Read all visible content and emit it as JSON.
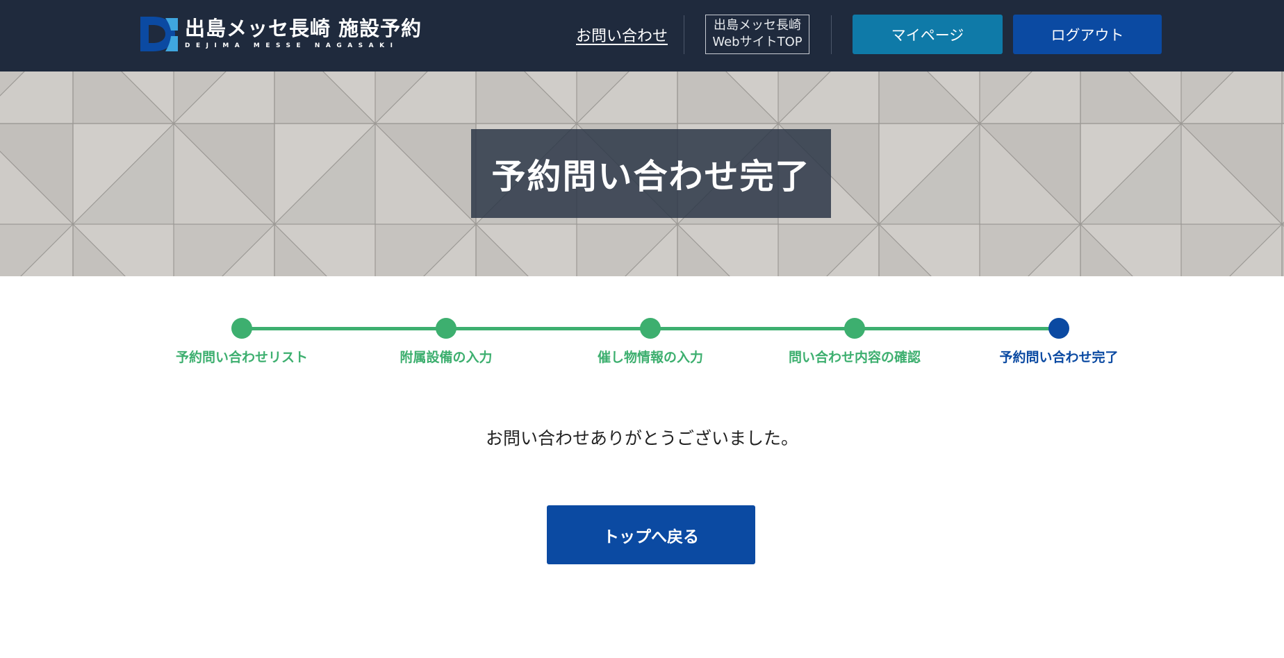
{
  "header": {
    "logo_title": "出島メッセ長崎 施設予約",
    "logo_subtitle": "DEJIMA MESSE NAGASAKI",
    "contact_link": "お問い合わせ",
    "site_top_line1": "出島メッセ長崎",
    "site_top_line2": "WebサイトTOP",
    "mypage_button": "マイページ",
    "logout_button": "ログアウト"
  },
  "hero": {
    "title": "予約問い合わせ完了"
  },
  "steps": [
    {
      "label": "予約問い合わせリスト",
      "status": "done"
    },
    {
      "label": "附属設備の入力",
      "status": "done"
    },
    {
      "label": "催し物情報の入力",
      "status": "done"
    },
    {
      "label": "問い合わせ内容の確認",
      "status": "done"
    },
    {
      "label": "予約問い合わせ完了",
      "status": "current"
    }
  ],
  "main": {
    "message": "お問い合わせありがとうございました。",
    "back_button": "トップへ戻る"
  },
  "colors": {
    "header_bg": "#1f2a3d",
    "step_done": "#3daf6f",
    "step_current": "#0b4aa2",
    "mypage_bg": "#0f7aa8",
    "primary_bg": "#0b4aa2"
  }
}
